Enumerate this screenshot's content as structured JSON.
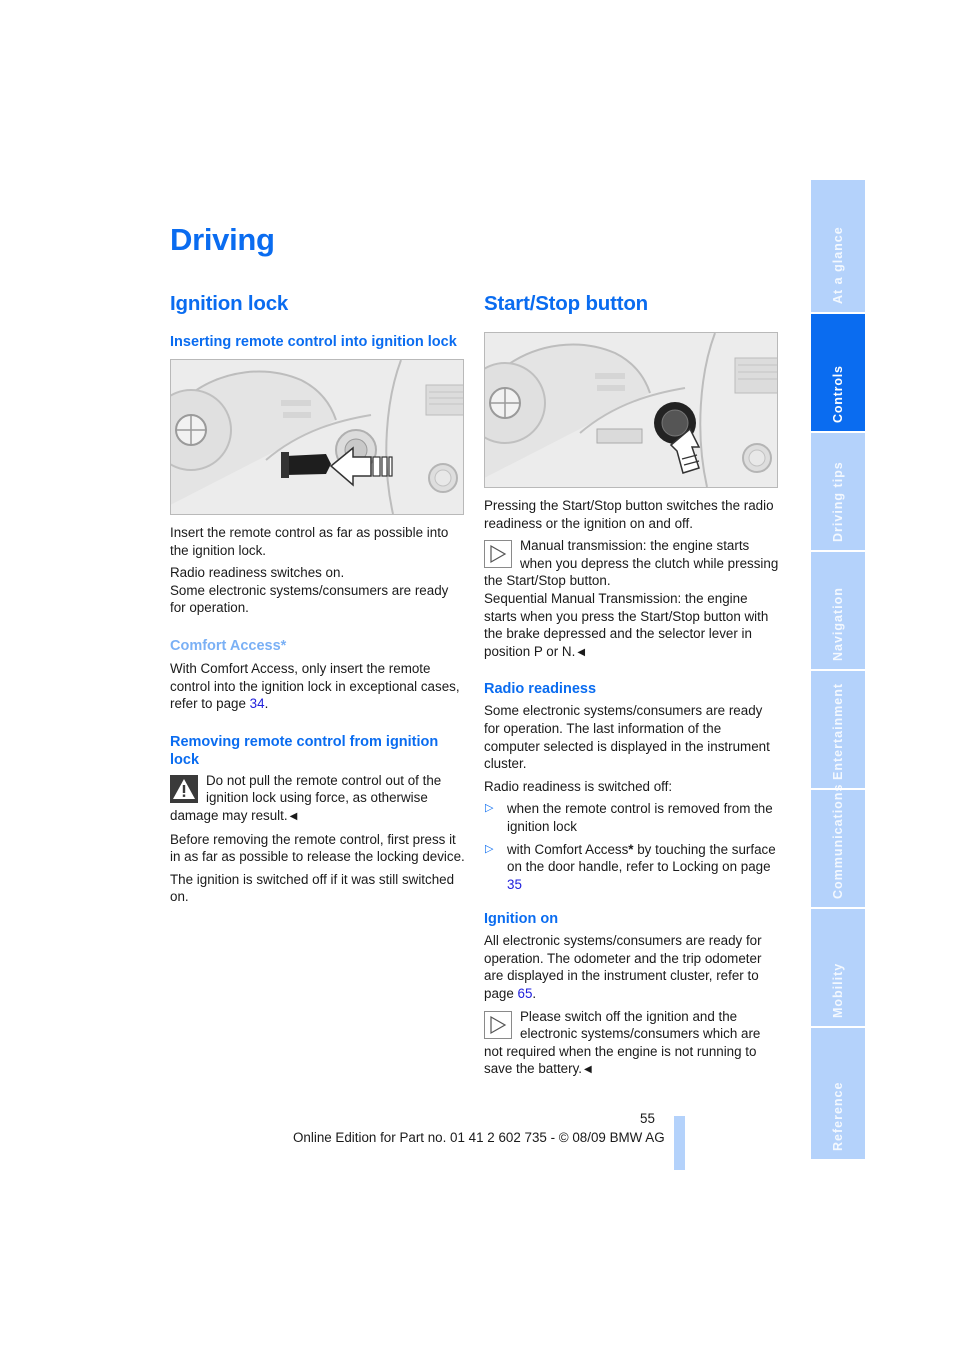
{
  "page": {
    "title": "Driving",
    "page_number": "55",
    "footer": "Online Edition for Part no. 01 41 2 602 735 - © 08/09 BMW AG"
  },
  "colors": {
    "heading_blue": "#0a6cf0",
    "light_heading_blue": "#7ab0f5",
    "tab_inactive": "#b4d2fb",
    "tab_active": "#0a6cf0",
    "link": "#1f1fdc"
  },
  "left_column": {
    "section_title": "Ignition lock",
    "inserting": {
      "heading": "Inserting remote control into ignition lock",
      "figure_alt": "Remote control being inserted into ignition lock",
      "para1": "Insert the remote control as far as possible into the ignition lock.",
      "para2_line1": "Radio readiness switches on.",
      "para2_line2": "Some electronic systems/consumers are ready for operation."
    },
    "comfort_access": {
      "heading": "Comfort Access*",
      "text_before_link": "With Comfort Access, only insert the remote control into the ignition lock in exceptional cases, refer to page ",
      "link": "34",
      "text_after_link": "."
    },
    "removing": {
      "heading": "Removing remote control from ignition lock",
      "warning_icon": "warning-triangle-icon",
      "warning_text": "Do not pull the remote control out of the ignition lock using force, as otherwise damage may result.",
      "end_mark": "◀",
      "para1": "Before removing the remote control, first press it in as far as possible to release the locking device.",
      "para2": "The ignition is switched off if it was still switched on."
    }
  },
  "right_column": {
    "section_title": "Start/Stop button",
    "figure_alt": "Start/Stop button being pressed",
    "intro": "Pressing the Start/Stop button switches the radio readiness or the ignition on and off.",
    "note1": {
      "icon": "note-triangle-icon",
      "text1": "Manual transmission: the engine starts when you depress the clutch while pressing the Start/Stop button.",
      "text2": "Sequential Manual Transmission: the engine starts when you press the Start/Stop button with the brake depressed and the selector lever in position P or N.",
      "end_mark": "◀"
    },
    "radio_readiness": {
      "heading": "Radio readiness",
      "para1": "Some electronic systems/consumers are ready for operation. The last information of the computer selected is displayed in the instrument cluster.",
      "para2": "Radio readiness is switched off:",
      "bullets": [
        {
          "text": "when the remote control is removed from the ignition lock"
        },
        {
          "text_before_star": "with Comfort Access",
          "star": "*",
          "text_after_star": " by touching the surface on the door handle, refer to Locking on page ",
          "link": "35"
        }
      ],
      "bullet_icon": "▷"
    },
    "ignition_on": {
      "heading": "Ignition on",
      "text_before_link": "All electronic systems/consumers are ready for operation. The odometer and the trip odometer are displayed in the instrument cluster, refer to page ",
      "link": "65",
      "text_after_link": ".",
      "note": {
        "icon": "note-triangle-icon",
        "text": "Please switch off the ignition and the electronic systems/consumers which are not required when the engine is not running to save the battery.",
        "end_mark": "◀"
      }
    }
  },
  "sidebar": {
    "tabs": [
      {
        "label": "At a glance",
        "active": false
      },
      {
        "label": "Controls",
        "active": true
      },
      {
        "label": "Driving tips",
        "active": false
      },
      {
        "label": "Navigation",
        "active": false
      },
      {
        "label": "Entertainment",
        "active": false
      },
      {
        "label": "Communications",
        "active": false
      },
      {
        "label": "Mobility",
        "active": false
      },
      {
        "label": "Reference",
        "active": false
      }
    ]
  }
}
